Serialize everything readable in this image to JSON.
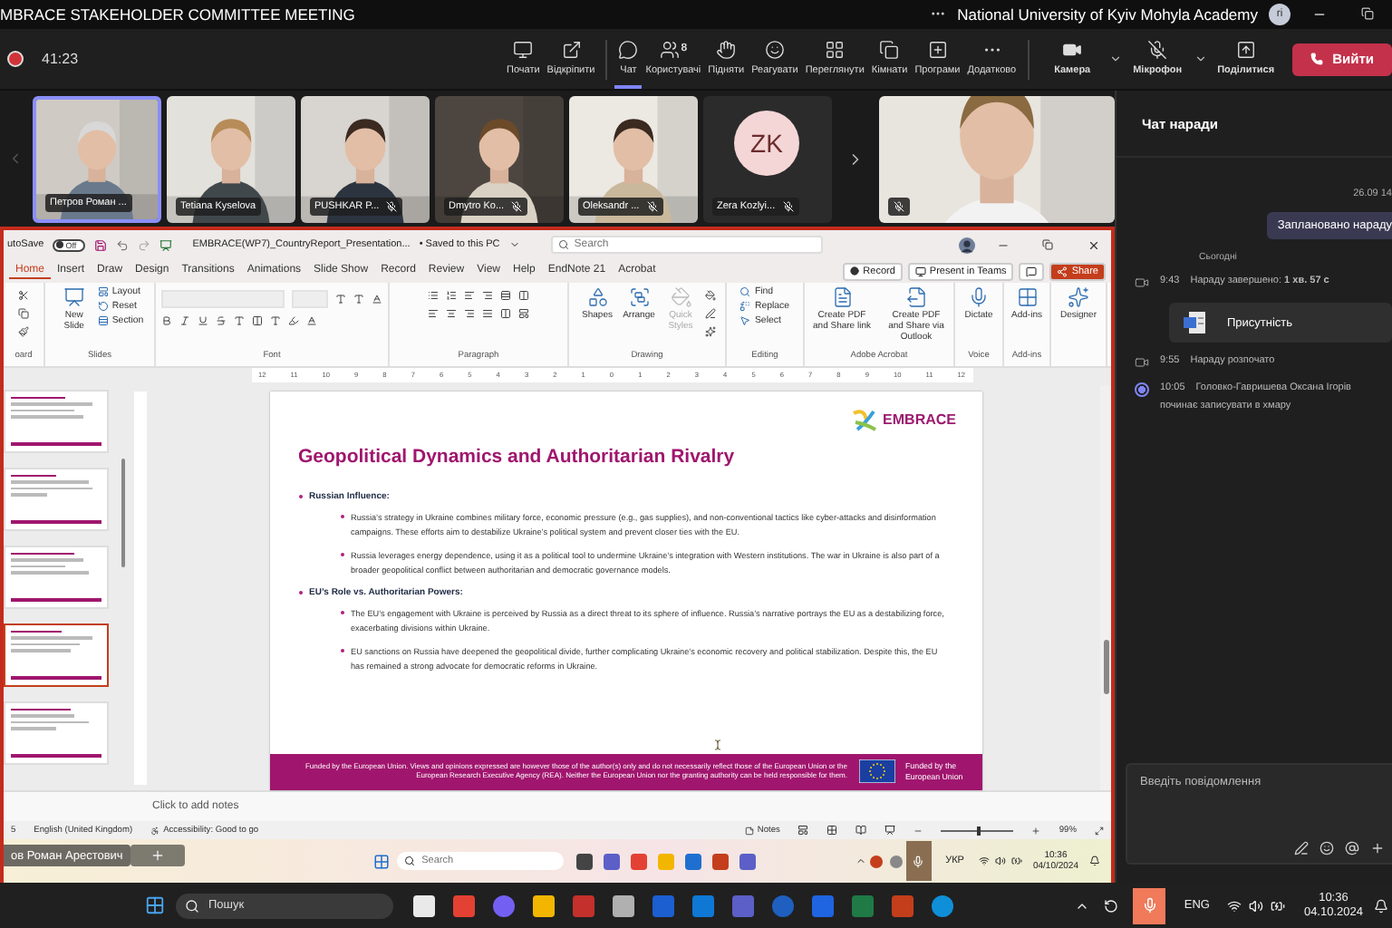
{
  "meeting": {
    "title": "MBRACE STAKEHOLDER COMMITTEE MEETING",
    "organization": "National University of Kyiv Mohyla Academy",
    "avatar_initials": "ri",
    "recording": true,
    "elapsed": "41:23"
  },
  "toolbar": [
    {
      "label": "Почати",
      "selected": false
    },
    {
      "label": "Відкріпити",
      "selected": false
    },
    {
      "label": "Чат",
      "selected": true
    },
    {
      "label": "Користувачі",
      "count": "8",
      "selected": false
    },
    {
      "label": "Підняти",
      "selected": false
    },
    {
      "label": "Реагувати",
      "selected": false
    },
    {
      "label": "Переглянути",
      "selected": false
    },
    {
      "label": "Кімнати",
      "selected": false
    },
    {
      "label": "Програми",
      "selected": false
    },
    {
      "label": "Додатково",
      "selected": false
    }
  ],
  "devices": [
    {
      "label": "Камера",
      "on": true
    },
    {
      "label": "Мікрофон",
      "on": false
    }
  ],
  "share_button": "Поділитися",
  "leave_button": "Вийти",
  "participants": [
    {
      "kind": "video",
      "name": "Петров Роман ...",
      "muted": false,
      "selected": true
    },
    {
      "kind": "video",
      "name": "Tetiana Kyselova",
      "muted": false,
      "selected": false
    },
    {
      "kind": "video",
      "name": "PUSHKAR P...",
      "muted": true,
      "selected": false
    },
    {
      "kind": "video",
      "name": "Dmytro Ko...",
      "muted": true,
      "selected": false
    },
    {
      "kind": "video",
      "name": "Oleksandr ...",
      "muted": true,
      "selected": false
    },
    {
      "kind": "initials",
      "initials": "ZK",
      "name": "Zera Kozlyi...",
      "muted": true,
      "selected": false
    }
  ],
  "spotlight": {
    "kind": "video",
    "muted": true
  },
  "powerpoint": {
    "autosave_label": "utoSave",
    "autosave_on": false,
    "autosave_state": "Off",
    "file_name": "EMBRACE(WP7)_CountryReport_Presentation...",
    "save_status": "• Saved to this PC",
    "search_placeholder": "Search",
    "tabs": [
      {
        "label": "Home",
        "selected": true
      },
      {
        "label": "Insert",
        "selected": false
      },
      {
        "label": "Draw",
        "selected": false
      },
      {
        "label": "Design",
        "selected": false
      },
      {
        "label": "Transitions",
        "selected": false
      },
      {
        "label": "Animations",
        "selected": false
      },
      {
        "label": "Slide Show",
        "selected": false
      },
      {
        "label": "Record",
        "selected": false
      },
      {
        "label": "Review",
        "selected": false
      },
      {
        "label": "View",
        "selected": false
      },
      {
        "label": "Help",
        "selected": false
      },
      {
        "label": "EndNote 21",
        "selected": false
      },
      {
        "label": "Acrobat",
        "selected": false
      }
    ],
    "actions": [
      "Record",
      "Present in Teams",
      "Share"
    ],
    "ribbon": [
      {
        "kind": "clipboard",
        "label": "oard"
      },
      {
        "kind": "slides",
        "label": "Slides",
        "buttons": [
          {
            "label": "New Slide",
            "disabled": false
          },
          {
            "label": "Layout",
            "disabled": false
          },
          {
            "label": "Reset",
            "disabled": false
          },
          {
            "label": "Section",
            "disabled": false
          }
        ]
      },
      {
        "kind": "font",
        "label": "Font"
      },
      {
        "kind": "paragraph",
        "label": "Paragraph"
      },
      {
        "kind": "drawing",
        "label": "Drawing",
        "buttons": [
          {
            "label": "Shapes",
            "disabled": false
          },
          {
            "label": "Arrange",
            "disabled": false
          },
          {
            "label": "Quick Styles",
            "disabled": true
          }
        ]
      },
      {
        "kind": "editing",
        "label": "Editing",
        "buttons": [
          {
            "label": "Find",
            "disabled": false
          },
          {
            "label": "Replace",
            "disabled": false
          },
          {
            "label": "Select",
            "disabled": false
          }
        ]
      },
      {
        "kind": "acrobat",
        "label": "Adobe Acrobat",
        "buttons": [
          {
            "label": "Create PDF and Share link",
            "disabled": false
          },
          {
            "label": "Create PDF and Share via Outlook",
            "disabled": false
          }
        ]
      },
      {
        "kind": "voice",
        "label": "Voice",
        "buttons": [
          {
            "label": "Dictate",
            "disabled": false
          }
        ]
      },
      {
        "kind": "addins",
        "label": "Add-ins",
        "buttons": [
          {
            "label": "Add-ins",
            "disabled": false
          }
        ]
      },
      {
        "kind": "designer",
        "buttons": [
          {
            "label": "Designer",
            "disabled": false
          }
        ]
      }
    ],
    "ruler": [
      "12",
      "11",
      "10",
      "9",
      "8",
      "7",
      "6",
      "5",
      "4",
      "3",
      "2",
      "1",
      "0",
      "1",
      "2",
      "3",
      "4",
      "5",
      "6",
      "7",
      "8",
      "9",
      "10",
      "11",
      "12"
    ],
    "thumbnails": [
      {
        "selected": false
      },
      {
        "selected": false
      },
      {
        "selected": false
      },
      {
        "selected": true
      },
      {
        "selected": false
      }
    ],
    "slide": {
      "logo": "EMBRACE",
      "title": "Geopolitical Dynamics and Authoritarian Rivalry",
      "sections": [
        {
          "heading": "Russian Influence:",
          "bullets": [
            "Russia’s strategy in Ukraine combines military force, economic pressure (e.g., gas supplies), and non-conventional tactics like cyber-attacks and disinformation campaigns. These efforts aim to destabilize Ukraine’s political system and prevent closer ties with the EU.",
            "Russia leverages energy dependence, using it as a political tool to undermine Ukraine’s integration with Western institutions. The war in Ukraine is also part of a broader geopolitical conflict between authoritarian and democratic governance models."
          ]
        },
        {
          "heading": "EU’s Role vs. Authoritarian Powers:",
          "bullets": [
            "The EU’s engagement with Ukraine is perceived by Russia as a direct threat to its sphere of influence. Russia’s narrative portrays the EU as a destabilizing force, exacerbating divisions within Ukraine.",
            "EU sanctions on Russia have deepened the geopolitical divide, further complicating Ukraine’s economic recovery and political stabilization. Despite this, the EU has remained a strong advocate for democratic reforms in Ukraine."
          ]
        }
      ],
      "disclaimer": "Funded by the European Union. Views and opinions expressed are however those of the author(s) only and do not necessarily reflect those of the European Union or the European Research Executive Agency (REA). Neither the European Union nor the granting authority can be held responsible for them.",
      "funding": "Funded by the European Union"
    },
    "notes_placeholder": "Click to add notes",
    "status": {
      "slide": "5",
      "language": "English (United Kingdom)",
      "accessibility": "Accessibility: Good to go",
      "notes": "Notes",
      "zoom": "99%",
      "zoom_slider": {
        "level": 0.5
      }
    }
  },
  "presenter_tag": "ов Роман Арестович",
  "inner_taskbar": {
    "search_placeholder": "Search",
    "language": "УКР",
    "time": "10:36",
    "date": "04/10/2024"
  },
  "chat": {
    "title": "Чат наради",
    "items": [
      {
        "kind": "timestamp",
        "text": "26.09 14"
      },
      {
        "kind": "bubble",
        "text": "Заплановано нараду"
      },
      {
        "kind": "divider",
        "text": "Сьогодні"
      },
      {
        "kind": "event",
        "time": "9:43",
        "text": "Нараду завершено: **1 хв. 57 с**"
      },
      {
        "kind": "card",
        "text": "Присутність"
      },
      {
        "kind": "event",
        "time": "9:55",
        "text": "Нараду розпочато"
      },
      {
        "kind": "recording",
        "time": "10:05",
        "text": "Головко-Гавришева Оксана Ігорів",
        "detail": "починає записувати в хмару"
      }
    ],
    "composer_placeholder": "Введіть повідомлення"
  },
  "taskbar": {
    "search_placeholder": "Пошук",
    "language": "ENG",
    "time": "10:36",
    "date": "04.10.2024"
  }
}
